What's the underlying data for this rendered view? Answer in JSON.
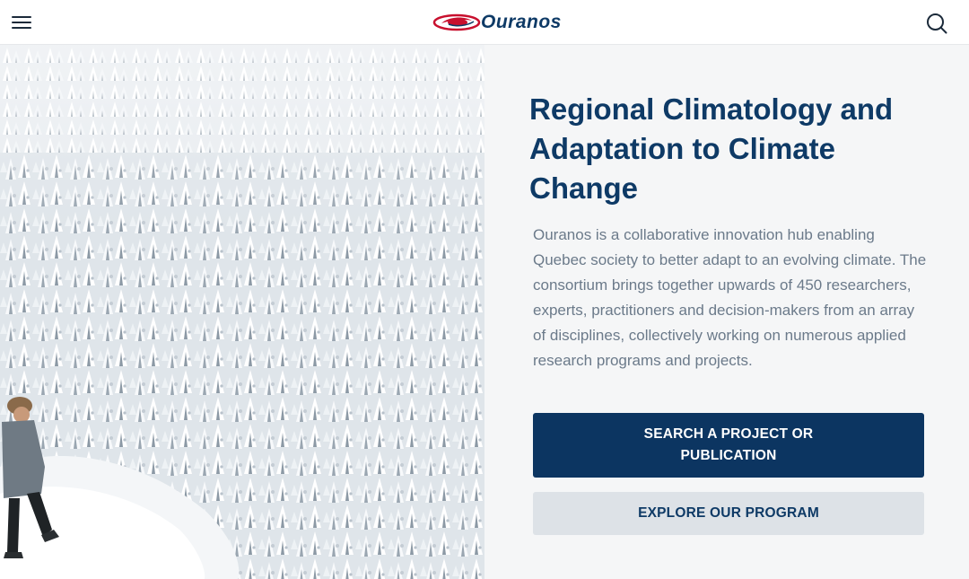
{
  "header": {
    "brand_name": "Ouranos",
    "menu_icon": "hamburger-menu-icon",
    "search_icon": "search-icon",
    "brand_color": "#0e3a66",
    "logo_accent_color": "#c8102e"
  },
  "hero": {
    "image": "snow-covered-forest-with-hiker",
    "title": "Regional Climatology and Adaptation to Climate Change",
    "description": "Ouranos is a collaborative innovation hub enabling Quebec society to better adapt to an evolving climate. The consortium brings together upwards of 450 researchers, experts, practitioners and decision-makers from an array of disciplines, collectively working on numerous applied research programs and projects.",
    "primary_button": "SEARCH A PROJECT OR PUBLICATION",
    "secondary_button": "EXPLORE OUR PROGRAM",
    "primary_button_color": "#0c3561",
    "secondary_button_color": "#dde2e7"
  }
}
